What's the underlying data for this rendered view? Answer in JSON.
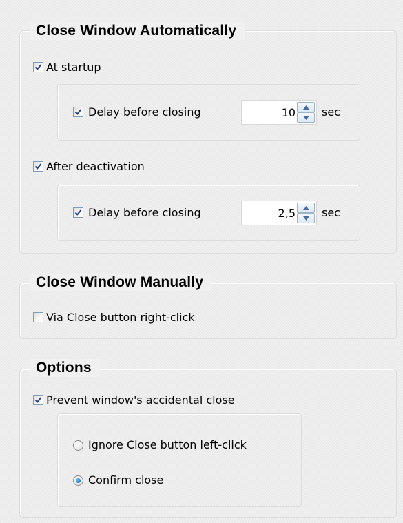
{
  "auto_group": {
    "title": "Close Window Automatically",
    "at_startup": {
      "label": "At startup",
      "checked": true,
      "delay": {
        "label": "Delay before closing",
        "checked": true,
        "value": "10",
        "unit": "sec"
      }
    },
    "after_deactivation": {
      "label": "After deactivation",
      "checked": true,
      "delay": {
        "label": "Delay before closing",
        "checked": true,
        "value": "2,5",
        "unit": "sec"
      }
    }
  },
  "manual_group": {
    "title": "Close Window Manually",
    "right_click": {
      "label": "Via Close button right-click",
      "checked": false
    }
  },
  "options_group": {
    "title": "Options",
    "prevent_close": {
      "label": "Prevent window's accidental close",
      "checked": true
    },
    "radios": [
      {
        "label": "Ignore Close button left-click",
        "selected": false
      },
      {
        "label": "Confirm close",
        "selected": true
      }
    ]
  },
  "colors": {
    "check": "#1f3e8a",
    "radio_dot": "#2a7ac8",
    "border": "#dcdcdc"
  }
}
